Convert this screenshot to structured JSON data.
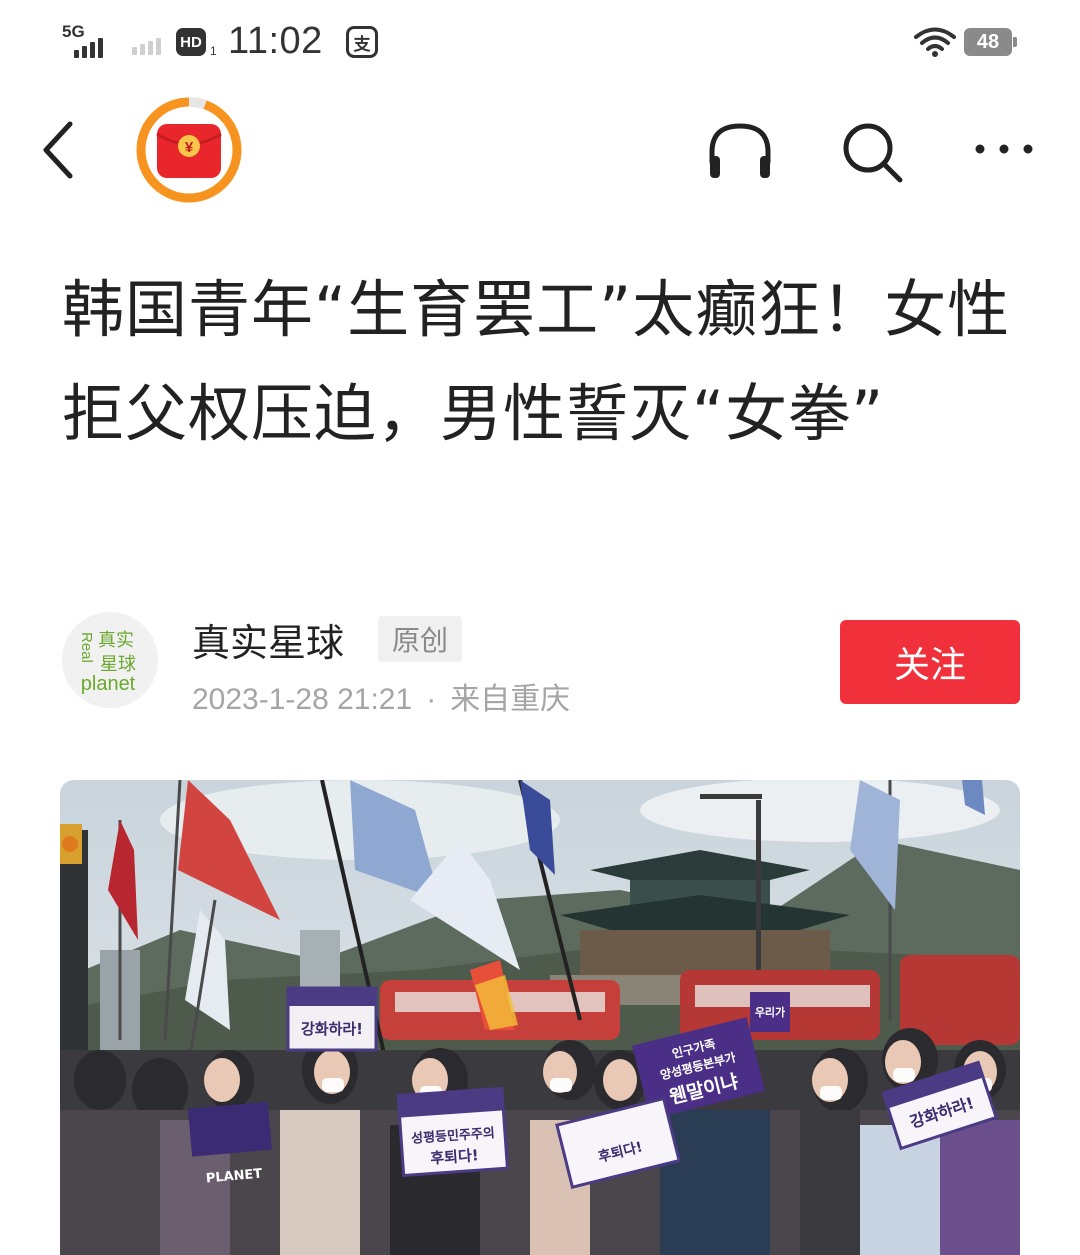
{
  "status_bar": {
    "network": "5G",
    "hd_label": "HD",
    "hd_sub": "1",
    "time": "11:02",
    "app_glyph": "支",
    "battery": "48"
  },
  "nav": {
    "back_icon": "chevron-left-icon",
    "badge_icon": "red-packet-icon",
    "badge_symbol": "¥",
    "listen_icon": "headphone-icon",
    "search_icon": "search-icon",
    "more_icon": "more-dots-icon"
  },
  "article": {
    "title": "韩国青年“生育罢工”太癫狂！女性拒父权压迫，男性誓灭“女拳”"
  },
  "author": {
    "name": "真实星球",
    "original_label": "原创",
    "date": "2023-1-28 21:21",
    "separator": "·",
    "location": "来自重庆",
    "follow_label": "关注",
    "avatar_text_cn1": "真实",
    "avatar_text_cn2": "星球",
    "avatar_text_en1": "Real",
    "avatar_text_en2": "planet"
  },
  "photo": {
    "signs": [
      "강화하라!",
      "성평등민주주의",
      "후퇴다!",
      "인구가족",
      "양성평등본부가",
      "웬말이냐",
      "강화하라!",
      "PLANET",
      "우리가",
      "후퇴다!"
    ]
  },
  "colors": {
    "follow_red": "#f0303a",
    "badge_orange": "#f79420",
    "badge_red": "#e8262b"
  }
}
